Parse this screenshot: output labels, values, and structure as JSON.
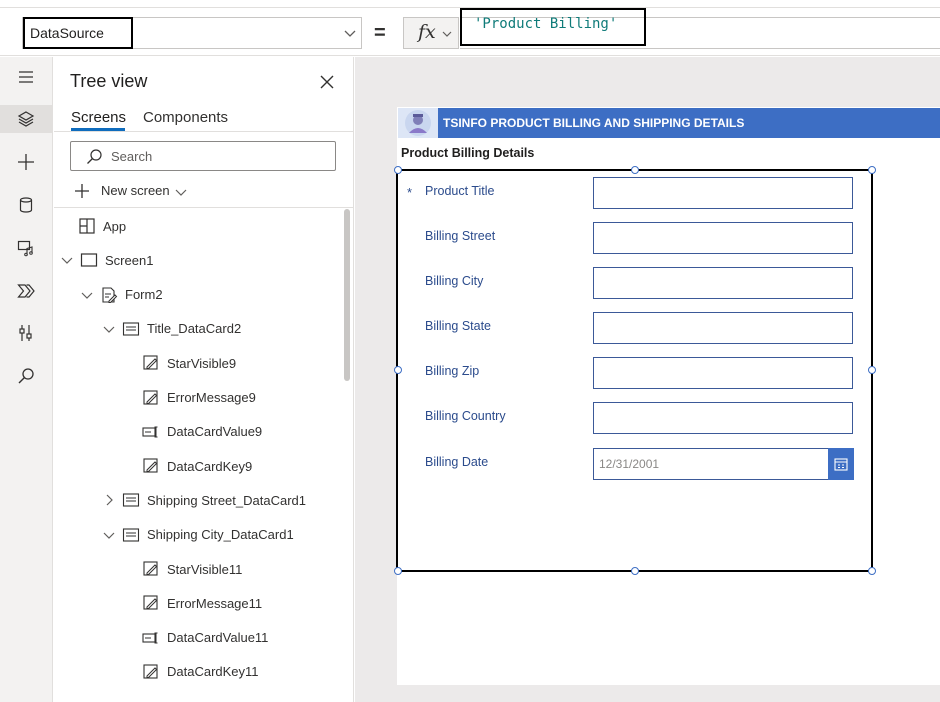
{
  "formula_bar": {
    "property": "DataSource",
    "fx_label": "fx",
    "formula": "'Product Billing'"
  },
  "equals_sign": "=",
  "tree_view": {
    "title": "Tree view",
    "tabs": [
      "Screens",
      "Components"
    ],
    "active_tab": "Screens",
    "search_placeholder": "Search",
    "new_screen_label": "New screen",
    "nodes": [
      {
        "label": "App",
        "icon": "app-icon",
        "level": 0,
        "chevron": "none"
      },
      {
        "label": "Screen1",
        "icon": "screen-icon",
        "level": 0,
        "chevron": "expanded"
      },
      {
        "label": "Form2",
        "icon": "form-icon",
        "level": 1,
        "chevron": "expanded"
      },
      {
        "label": "Title_DataCard2",
        "icon": "datacard-icon",
        "level": 2,
        "chevron": "expanded"
      },
      {
        "label": "StarVisible9",
        "icon": "label-edit-icon",
        "level": 3,
        "chevron": "none"
      },
      {
        "label": "ErrorMessage9",
        "icon": "label-edit-icon",
        "level": 3,
        "chevron": "none"
      },
      {
        "label": "DataCardValue9",
        "icon": "textinput-icon",
        "level": 3,
        "chevron": "none"
      },
      {
        "label": "DataCardKey9",
        "icon": "label-edit-icon",
        "level": 3,
        "chevron": "none"
      },
      {
        "label": "Shipping Street_DataCard1",
        "icon": "datacard-icon",
        "level": 2,
        "chevron": "collapsed"
      },
      {
        "label": "Shipping City_DataCard1",
        "icon": "datacard-icon",
        "level": 2,
        "chevron": "expanded"
      },
      {
        "label": "StarVisible11",
        "icon": "label-edit-icon",
        "level": 3,
        "chevron": "none"
      },
      {
        "label": "ErrorMessage11",
        "icon": "label-edit-icon",
        "level": 3,
        "chevron": "none"
      },
      {
        "label": "DataCardValue11",
        "icon": "textinput-icon",
        "level": 3,
        "chevron": "none"
      },
      {
        "label": "DataCardKey11",
        "icon": "label-edit-icon",
        "level": 3,
        "chevron": "none"
      }
    ]
  },
  "left_rail_icons": [
    "hamburger-icon",
    "layers-icon",
    "plus-icon",
    "database-icon",
    "media-icon",
    "power-automate-icon",
    "tools-icon",
    "search-icon"
  ],
  "app": {
    "header_title": "TSINFO PRODUCT BILLING AND SHIPPING DETAILS",
    "form_heading": "Product Billing Details",
    "fields": [
      {
        "label": "Product Title",
        "required": true,
        "value": ""
      },
      {
        "label": "Billing Street",
        "required": false,
        "value": ""
      },
      {
        "label": "Billing City",
        "required": false,
        "value": ""
      },
      {
        "label": "Billing State",
        "required": false,
        "value": ""
      },
      {
        "label": "Billing Zip",
        "required": false,
        "value": ""
      },
      {
        "label": "Billing Country",
        "required": false,
        "value": ""
      },
      {
        "label": "Billing Date",
        "required": false,
        "value": "12/31/2001",
        "type": "date"
      }
    ],
    "required_marker": "*"
  },
  "colors": {
    "header_blue": "#3d6ec4",
    "field_border": "#3b5998",
    "label_blue": "#2b4b8c",
    "formula_teal": "#0f7b79",
    "selection_black": "#000000"
  }
}
